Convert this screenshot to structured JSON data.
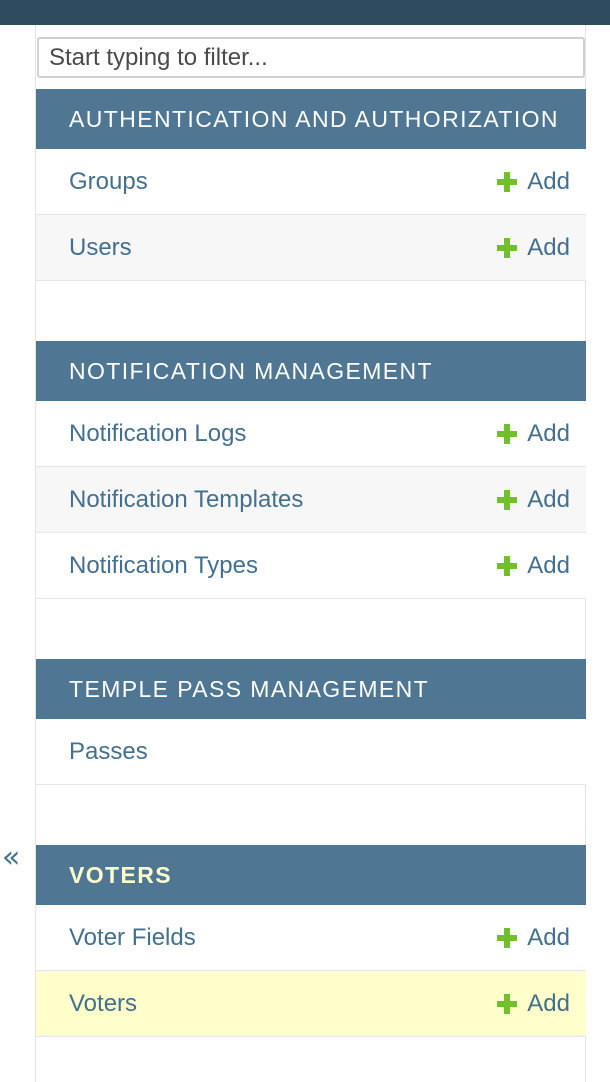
{
  "filter": {
    "placeholder": "Start typing to filter..."
  },
  "collapse_label": "«",
  "modules": [
    {
      "title": "Authentication and Authorization",
      "models": [
        {
          "name": "Groups",
          "add": "Add"
        },
        {
          "name": "Users",
          "add": "Add"
        }
      ]
    },
    {
      "title": "Notification Management",
      "models": [
        {
          "name": "Notification Logs",
          "add": "Add"
        },
        {
          "name": "Notification Templates",
          "add": "Add"
        },
        {
          "name": "Notification Types",
          "add": "Add"
        }
      ]
    },
    {
      "title": "Temple Pass Management",
      "models": [
        {
          "name": "Passes"
        }
      ]
    },
    {
      "title": "Voters",
      "current": true,
      "models": [
        {
          "name": "Voter Fields",
          "add": "Add"
        },
        {
          "name": "Voters",
          "add": "Add",
          "selected": true
        }
      ]
    }
  ],
  "colors": {
    "topbar": "#2f4b5f",
    "module_header": "#4f7693",
    "link": "#44708f",
    "add_icon": "#70bf2b",
    "selected_row": "#ffffcc",
    "current_header_text": "#ffffcc"
  }
}
